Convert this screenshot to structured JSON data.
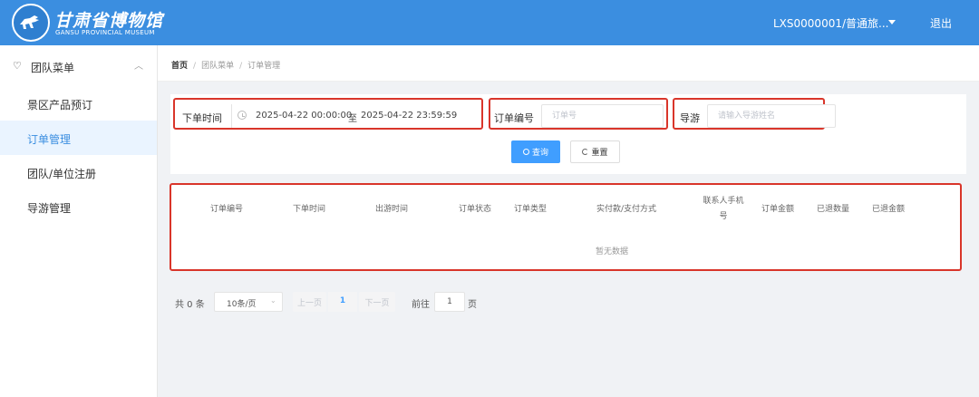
{
  "header": {
    "logo_title": "甘肃省博物馆",
    "logo_subtitle": "GANSU PROVINCIAL MUSEUM",
    "user": "LXS0000001/普通旅...",
    "logout": "退出",
    "bg_color": "#3b8ee0"
  },
  "sidebar": {
    "group_icon": "heart-icon",
    "group_label": "团队菜单",
    "items": [
      {
        "label": "景区产品预订",
        "active": false
      },
      {
        "label": "订单管理",
        "active": true
      },
      {
        "label": "团队/单位注册",
        "active": false
      },
      {
        "label": "导游管理",
        "active": false
      }
    ]
  },
  "breadcrumb": [
    "首页",
    "团队菜单",
    "订单管理"
  ],
  "search": {
    "order_time_label": "下单时间",
    "date_start": "2025-04-22 00:00:00",
    "date_sep": "至",
    "date_end": "2025-04-22 23:59:59",
    "order_no_label": "订单编号",
    "order_no_placeholder": "订单号",
    "guide_label": "导游",
    "guide_placeholder": "请输入导游姓名",
    "query_button": "查询",
    "reset_button": "重置"
  },
  "table": {
    "columns": [
      "订单编号",
      "下单时间",
      "出游时间",
      "订单状态",
      "订单类型",
      "实付款/支付方式",
      "联系人手机号",
      "订单金额",
      "已退数量",
      "已退金额"
    ],
    "contact_line1": "联系人手机",
    "contact_line2": "号",
    "rows": [],
    "empty_text": "暂无数据"
  },
  "pagination": {
    "total": "共 0 条",
    "page_size": "10条/页",
    "prev": "上一页",
    "current": "1",
    "next": "下一页",
    "goto_label": "前往",
    "goto_value": "1",
    "page_unit": "页"
  },
  "colors": {
    "accent": "#409eff",
    "highlight": "#d9352a",
    "active_bg": "#eaf4ff"
  }
}
